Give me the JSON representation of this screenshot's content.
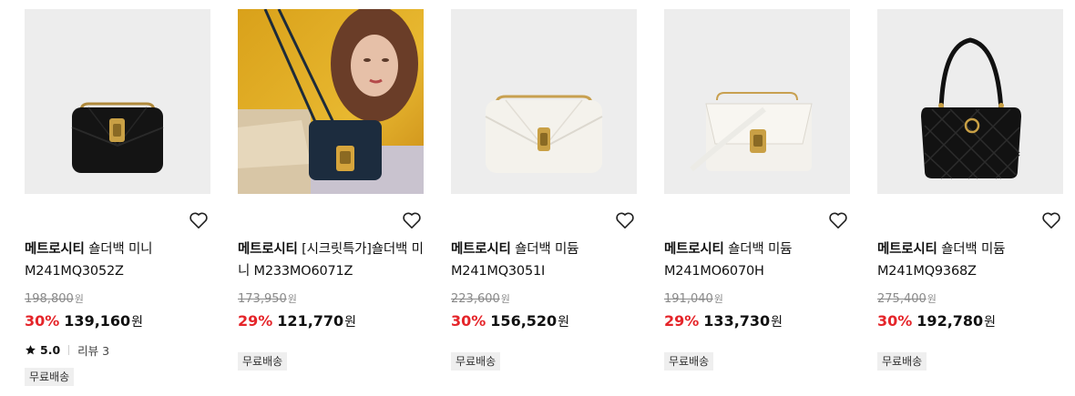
{
  "products": [
    {
      "brand": "메트로시티",
      "name": "숄더백 미니 M241MQ3052Z",
      "orig": "198,800",
      "won": "원",
      "pct": "30%",
      "price": "139,160",
      "rating": "5.0",
      "review_label": "리뷰 3",
      "badge": "무료배송"
    },
    {
      "brand": "메트로시티",
      "name": "[시크릿특가]숄더백 미니 M233MO6071Z",
      "orig": "173,950",
      "won": "원",
      "pct": "29%",
      "price": "121,770",
      "badge": "무료배송"
    },
    {
      "brand": "메트로시티",
      "name": "숄더백 미듐 M241MQ3051I",
      "orig": "223,600",
      "won": "원",
      "pct": "30%",
      "price": "156,520",
      "badge": "무료배송"
    },
    {
      "brand": "메트로시티",
      "name": "숄더백 미듐 M241MO6070H",
      "orig": "191,040",
      "won": "원",
      "pct": "29%",
      "price": "133,730",
      "badge": "무료배송"
    },
    {
      "brand": "메트로시티",
      "name": "숄더백 미듐 M241MQ9368Z",
      "orig": "275,400",
      "won": "원",
      "pct": "30%",
      "price": "192,780",
      "badge": "무료배송"
    }
  ],
  "colors": {
    "discount": "#e5252a",
    "strike": "#8a8a8a",
    "thumb_bg": "#ededed",
    "badge_bg": "#efefef"
  },
  "icons": {
    "wishlist": "heart-outline-icon",
    "rating": "star-icon"
  }
}
